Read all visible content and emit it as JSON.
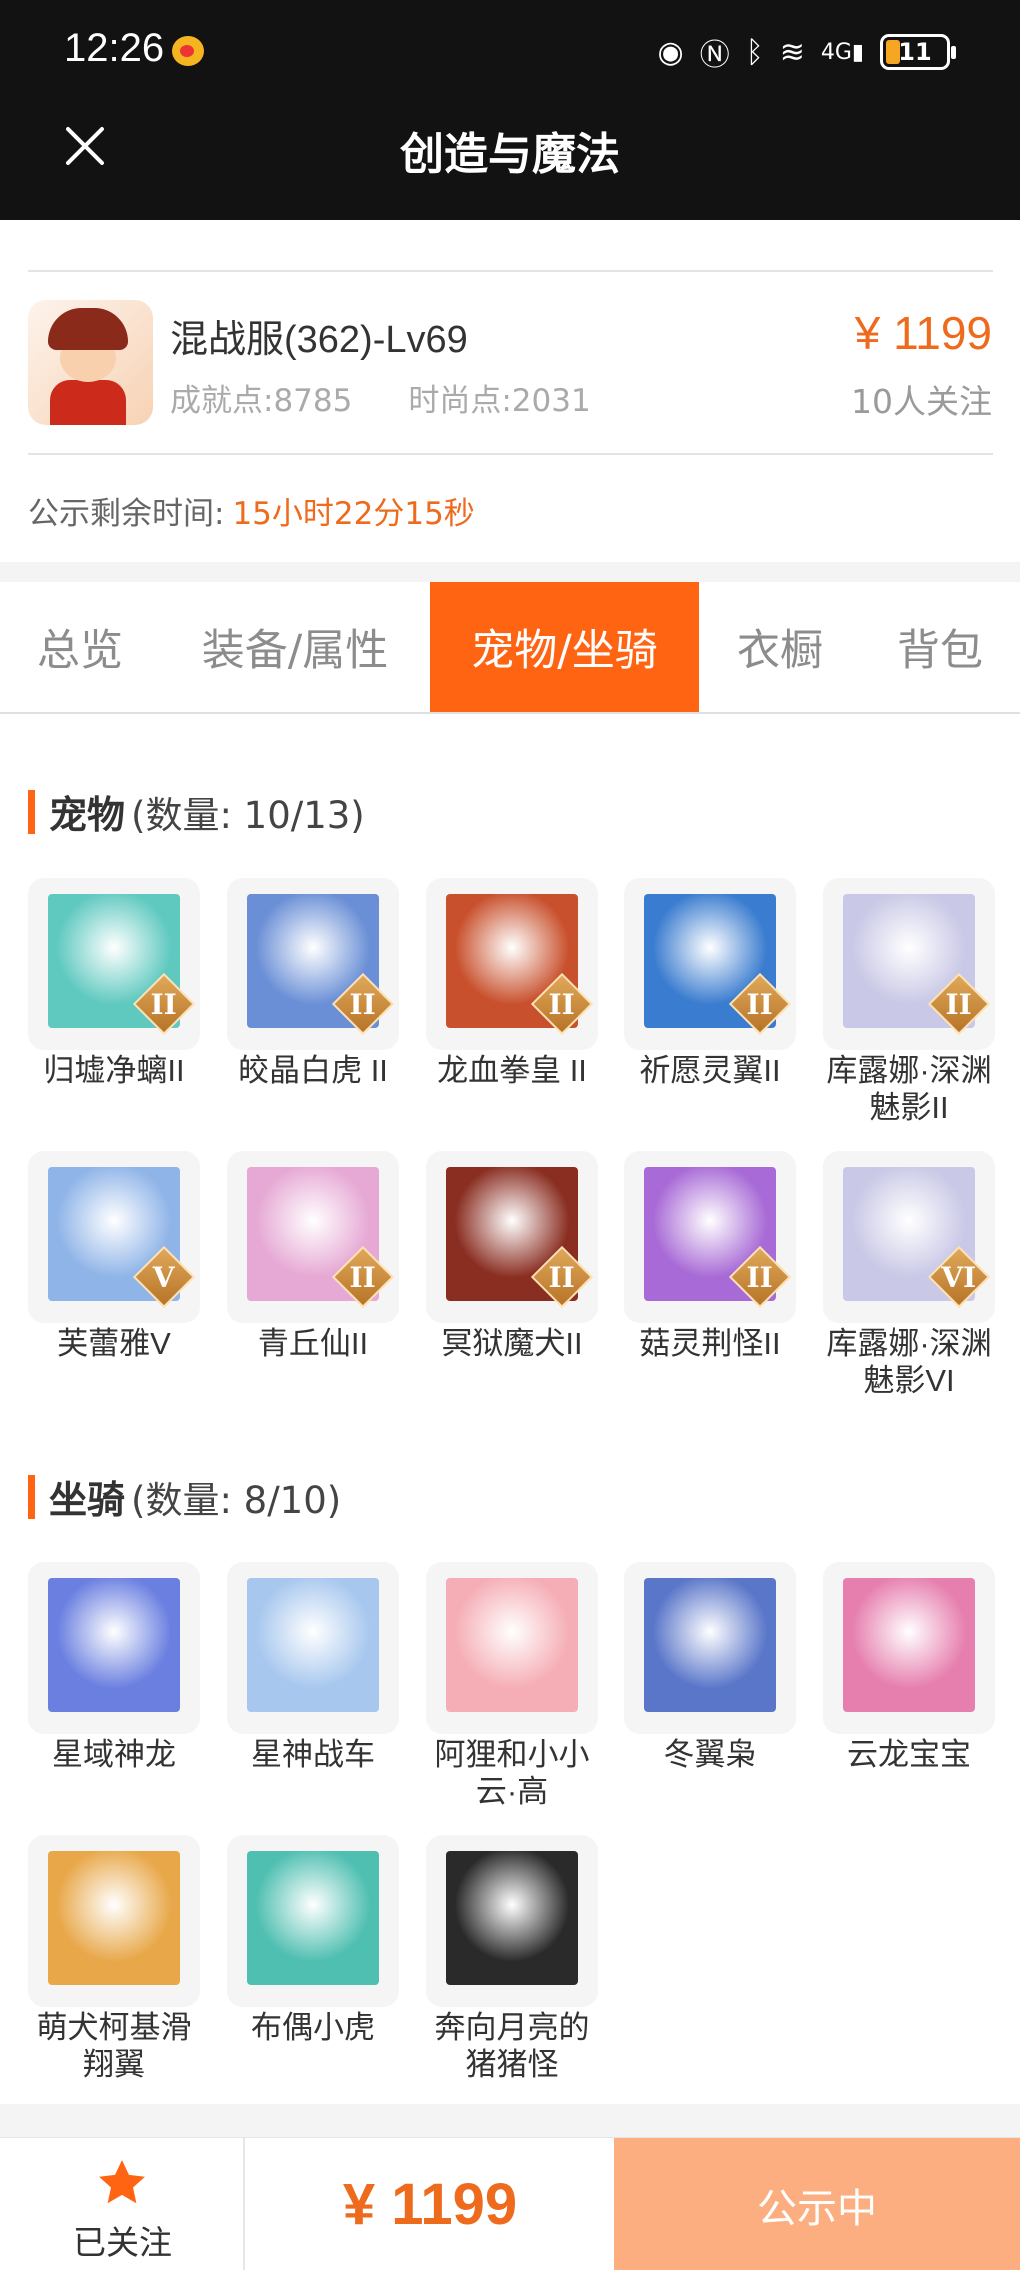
{
  "status_bar": {
    "time": "12:26",
    "battery": "11",
    "network": "4G"
  },
  "header": {
    "title": "创造与魔法",
    "close_icon": "close-icon"
  },
  "listing": {
    "server": "混战服(362)-Lv69",
    "achievement": "成就点:8785",
    "fashion": "时尚点:2031",
    "price": "¥ 1199",
    "followers": "10人关注",
    "remaining_label": "公示剩余时间:",
    "remaining_time": "15小时22分15秒"
  },
  "tabs": [
    {
      "label": "总览"
    },
    {
      "label": "装备/属性"
    },
    {
      "label": "宠物/坐骑",
      "active": true
    },
    {
      "label": "衣橱"
    },
    {
      "label": "背包"
    }
  ],
  "pets": {
    "title": "宠物",
    "count": "(数量: 10/13)",
    "items": [
      {
        "name": "归墟净螭II",
        "badge": "II",
        "color": "#5fc9c0"
      },
      {
        "name": "皎晶白虎 II",
        "badge": "II",
        "color": "#6a8fd6"
      },
      {
        "name": "龙血拳皇 II",
        "badge": "II",
        "color": "#c8502c"
      },
      {
        "name": "祈愿灵翼II",
        "badge": "II",
        "color": "#3a7ccf"
      },
      {
        "name": "库露娜·深渊魅影II",
        "badge": "II",
        "color": "#c9c8e6"
      },
      {
        "name": "芙蕾雅V",
        "badge": "V",
        "color": "#8fb4e8"
      },
      {
        "name": "青丘仙II",
        "badge": "II",
        "color": "#e6a8d4"
      },
      {
        "name": "冥狱魔犬II",
        "badge": "II",
        "color": "#8a2e22"
      },
      {
        "name": "菇灵荆怪II",
        "badge": "II",
        "color": "#a86ad6"
      },
      {
        "name": "库露娜·深渊魅影VI",
        "badge": "VI",
        "color": "#c9c8e6"
      }
    ]
  },
  "mounts": {
    "title": "坐骑",
    "count": "(数量: 8/10)",
    "items": [
      {
        "name": "星域神龙",
        "color": "#6a7fe0"
      },
      {
        "name": "星神战车",
        "color": "#a7c7ee"
      },
      {
        "name": "阿狸和小小云·高",
        "color": "#f5aeb6"
      },
      {
        "name": "冬翼枭",
        "color": "#5a76c9"
      },
      {
        "name": "云龙宝宝",
        "color": "#e67fae"
      },
      {
        "name": "萌犬柯基滑翔翼",
        "color": "#e8a84a"
      },
      {
        "name": "布偶小虎",
        "color": "#4fbfb1"
      },
      {
        "name": "奔向月亮的猪猪怪",
        "color": "#2a2a2a"
      }
    ]
  },
  "bottom_bar": {
    "follow_label": "已关注",
    "price": "¥ 1199",
    "status_button": "公示中"
  }
}
